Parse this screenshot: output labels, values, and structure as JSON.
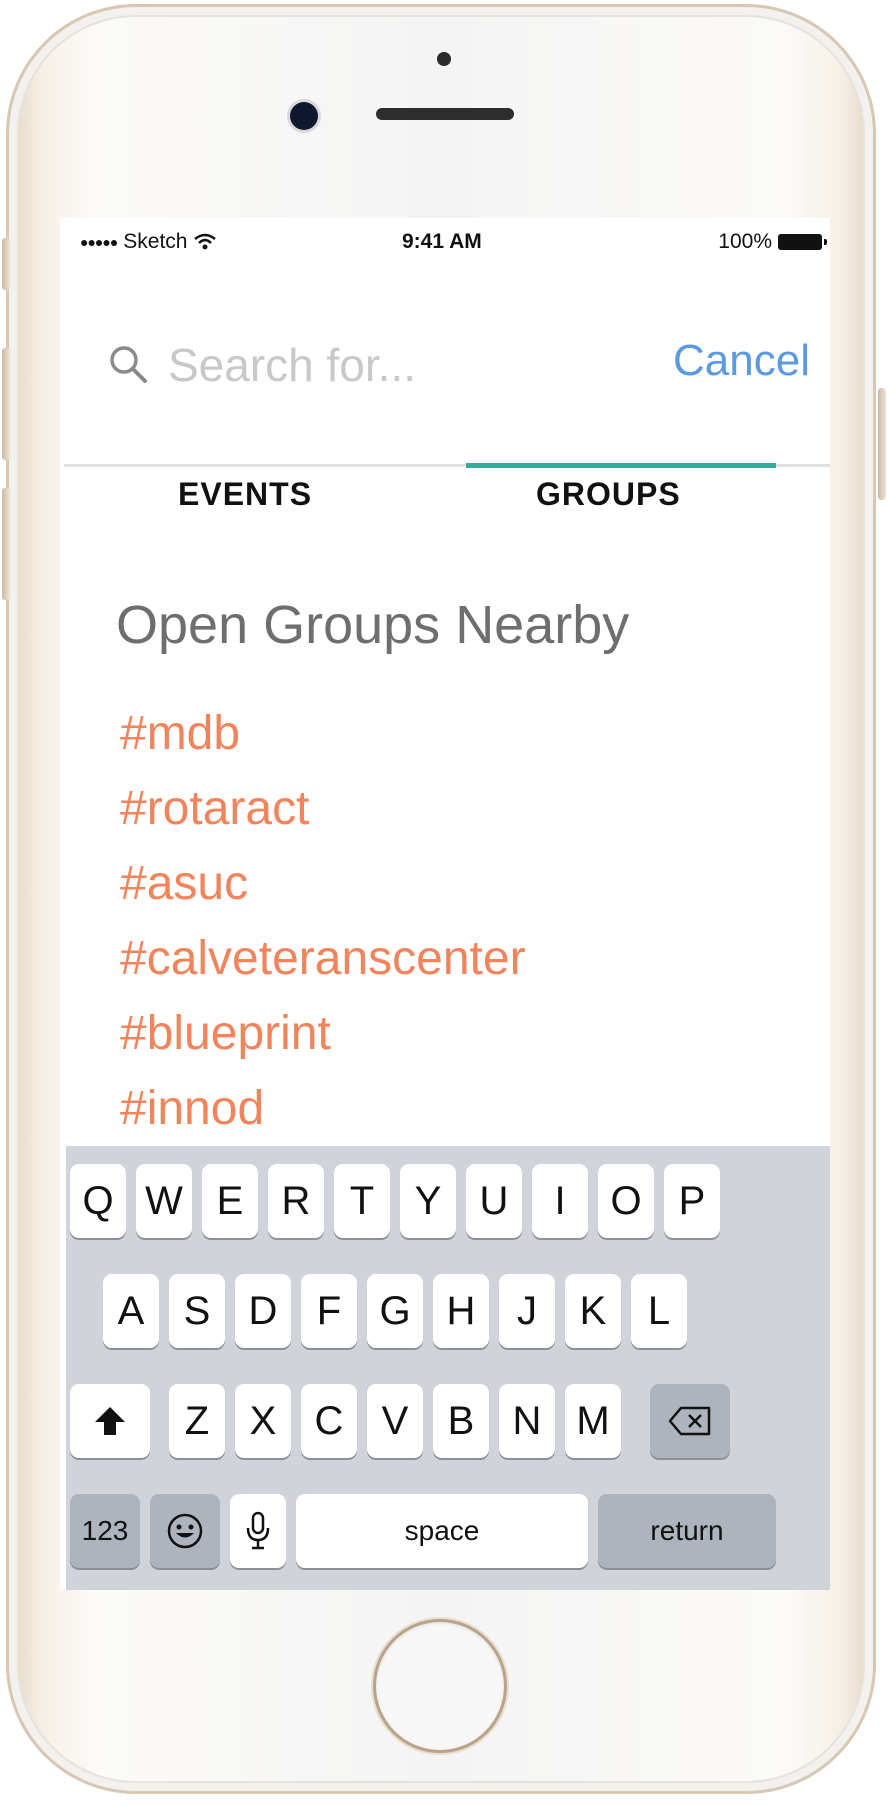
{
  "status_bar": {
    "signal": "●●●●●",
    "carrier": "Sketch",
    "time": "9:41 AM",
    "battery": "100%"
  },
  "search": {
    "placeholder": "Search for...",
    "cancel_label": "Cancel"
  },
  "tabs": [
    {
      "label": "EVENTS",
      "active": false
    },
    {
      "label": "GROUPS",
      "active": true
    }
  ],
  "section_title": "Open Groups Nearby",
  "groups": [
    "#mdb",
    "#rotaract",
    "#asuc",
    "#calveteranscenter",
    "#blueprint",
    "#innod"
  ],
  "colors": {
    "accent_tab": "#35a99a",
    "group_link": "#f2845c",
    "cancel": "#5b9ae0"
  },
  "keyboard": {
    "row1": [
      "Q",
      "W",
      "E",
      "R",
      "T",
      "Y",
      "U",
      "I",
      "O",
      "P"
    ],
    "row2": [
      "A",
      "S",
      "D",
      "F",
      "G",
      "H",
      "J",
      "K",
      "L"
    ],
    "row3": [
      "Z",
      "X",
      "C",
      "V",
      "B",
      "N",
      "M"
    ],
    "numbers_label": "123",
    "space_label": "space",
    "return_label": "return",
    "shift_icon": "shift-icon",
    "delete_icon": "backspace-icon",
    "emoji_icon": "emoji-icon",
    "mic_icon": "microphone-icon"
  }
}
